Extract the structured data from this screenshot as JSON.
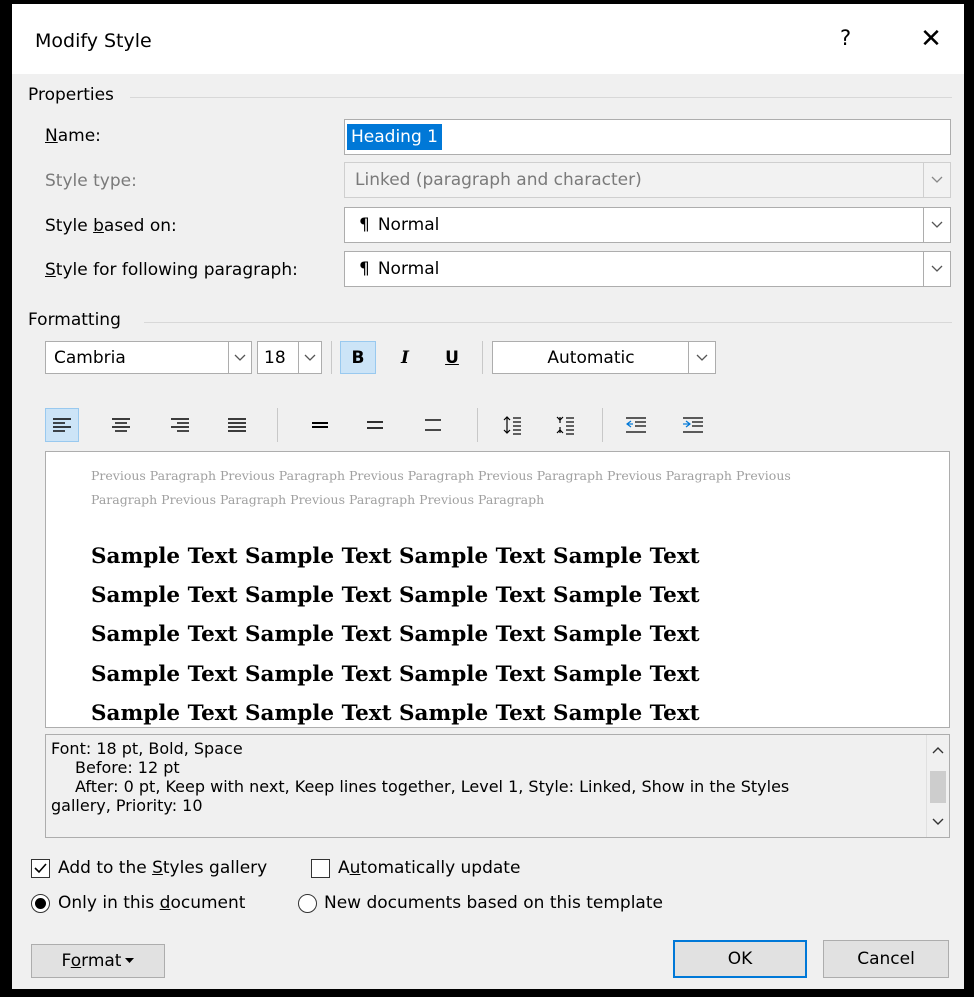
{
  "window": {
    "title": "Modify Style",
    "help_glyph": "?",
    "close_glyph": "✕"
  },
  "properties": {
    "group_label": "Properties",
    "name_label": "Name:",
    "name_value": "Heading 1",
    "style_type_label": "Style type:",
    "style_type_value": "Linked (paragraph and character)",
    "based_on_label": "Style based on:",
    "based_on_value": "Normal",
    "following_label": "Style for following paragraph:",
    "following_value": "Normal",
    "paragraph_mark": "¶"
  },
  "formatting": {
    "group_label": "Formatting",
    "font_name": "Cambria",
    "font_size": "18",
    "bold_label": "B",
    "italic_label": "I",
    "underline_label": "U",
    "color_value": "Automatic",
    "bold_active": true,
    "align_left_active": true
  },
  "preview": {
    "previous_paragraph": "Previous Paragraph Previous Paragraph Previous Paragraph Previous Paragraph Previous Paragraph Previous Paragraph Previous Paragraph Previous Paragraph Previous Paragraph",
    "sample_lines": [
      "Sample Text Sample Text Sample Text Sample Text",
      "Sample Text Sample Text Sample Text Sample Text",
      "Sample Text Sample Text Sample Text Sample Text",
      "Sample Text Sample Text Sample Text Sample Text",
      "Sample Text Sample Text Sample Text Sample Text"
    ]
  },
  "description": {
    "line1": "Font: 18 pt, Bold, Space",
    "line2": "Before:  12 pt",
    "line3": "After:  0 pt, Keep with next, Keep lines together, Level 1, Style: Linked, Show in the Styles",
    "line4": "gallery, Priority: 10"
  },
  "options": {
    "add_to_gallery_label": "Add to the Styles gallery",
    "add_to_gallery_checked": true,
    "auto_update_label": "Automatically update",
    "auto_update_checked": false,
    "only_this_doc_label": "Only in this document",
    "only_this_doc_selected": true,
    "new_docs_label": "New documents based on this template",
    "new_docs_selected": false
  },
  "buttons": {
    "format_label": "Format",
    "ok_label": "OK",
    "cancel_label": "Cancel"
  },
  "colors": {
    "accent": "#0078d7",
    "selection": "#0078d7",
    "toggle_active_bg": "#cce4f7",
    "toggle_active_border": "#99c9ef",
    "dialog_bg": "#f0f0f0"
  }
}
